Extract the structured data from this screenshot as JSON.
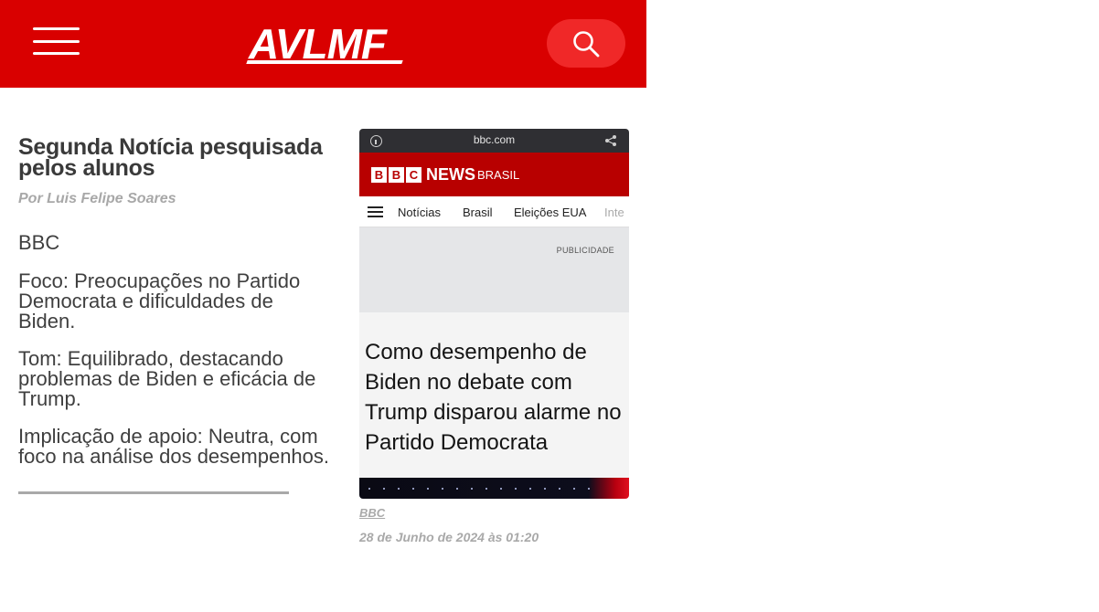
{
  "header": {
    "logo_text": "AVLMF",
    "brand_color": "#d90000",
    "search_button_color": "#f02828",
    "menu_icon": "hamburger-menu-icon",
    "search_icon": "search-icon"
  },
  "article": {
    "title": "Segunda Notícia pesquisada pelos alunos",
    "author": "Por Luis Felipe Soares",
    "paragraphs": [
      "BBC",
      "Foco: Preocupações no Partido Democrata e dificuldades de Biden.",
      "Tom: Equilibrado, destacando problemas de Biden e eficácia de Trump.",
      "Implicação de apoio: Neutra, com foco na análise dos desempenhos."
    ]
  },
  "image": {
    "url": "bbc.com",
    "brand_letters": [
      "B",
      "B",
      "C"
    ],
    "brand_news": "NEWS",
    "brand_region": "BRASIL",
    "nav_items": [
      "Notícias",
      "Brasil",
      "Eleições EUA",
      "Inte"
    ],
    "ad_label": "PUBLICIDADE",
    "headline": "Como desempenho de Biden no debate com Trump disparou alarme no Partido Democrata",
    "brand_color": "#b80000"
  },
  "caption": {
    "source": "BBC",
    "date": "28 de Junho de 2024 às 01:20"
  }
}
